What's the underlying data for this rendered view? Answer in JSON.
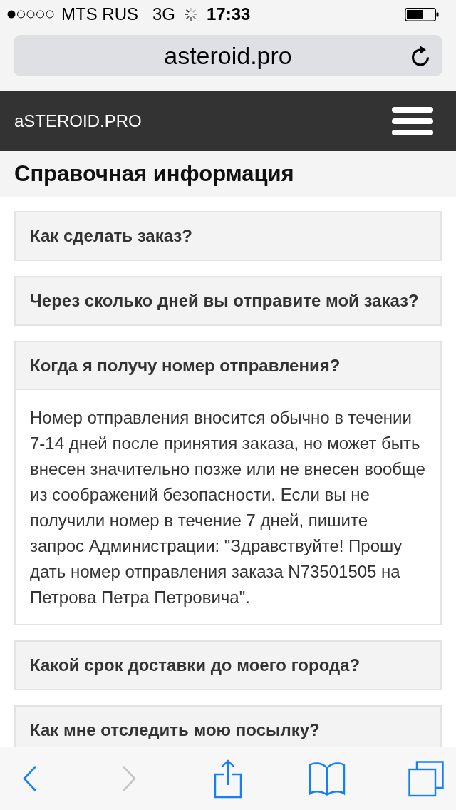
{
  "status_bar": {
    "carrier": "MTS RUS",
    "network": "3G",
    "loading": true,
    "time": "17:33"
  },
  "address_bar": {
    "url": "asteroid.pro"
  },
  "site_header": {
    "logo": "aSTEROID.PRO"
  },
  "page_title": "Справочная информация",
  "faq": [
    {
      "question": "Как сделать заказ?",
      "expanded": false
    },
    {
      "question": "Через сколько дней вы отправите мой заказ?",
      "expanded": false
    },
    {
      "question": "Когда я получу номер отправления?",
      "expanded": true,
      "answer": "Номер отправления вносится обычно в течении 7-14 дней после принятия заказа, но может быть внесен значительно позже или не внесен вообще из соображений безопасности. Если вы не получили номер в течение 7 дней, пишите запрос Администрации: \"Здравствуйте! Прошу дать номер отправления заказа N73501505 на Петрова Петра Петровича\"."
    },
    {
      "question": "Какой срок доставки до моего города?",
      "expanded": false
    },
    {
      "question": "Как мне отследить мою посылку?",
      "expanded": false
    }
  ],
  "toolbar": {
    "back": {
      "disabled": false
    },
    "forward": {
      "disabled": true
    }
  }
}
